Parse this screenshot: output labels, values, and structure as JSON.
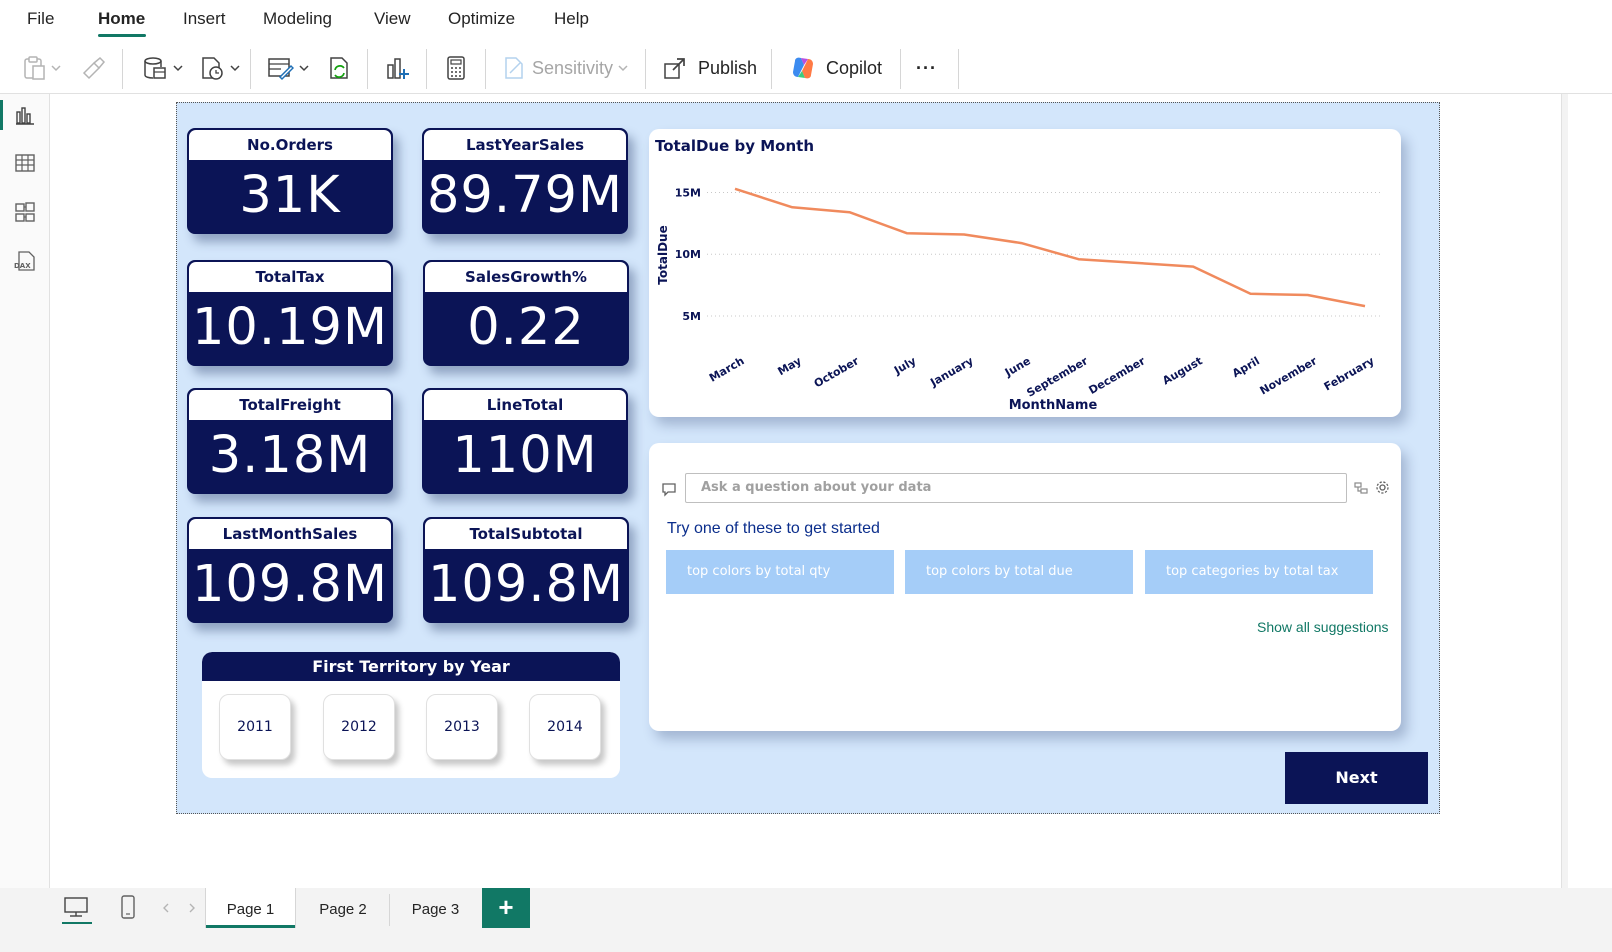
{
  "menu": {
    "items": [
      "File",
      "Home",
      "Insert",
      "Modeling",
      "View",
      "Optimize",
      "Help"
    ],
    "active": "Home"
  },
  "ribbon": {
    "sensitivity_label": "Sensitivity",
    "publish_label": "Publish",
    "copilot_label": "Copilot",
    "more_label": "···"
  },
  "colors": {
    "accent": "#117865",
    "navy": "#0b1456",
    "report_bg": "#d3e6fb",
    "line": "#f08a5d",
    "chip": "#a5cdf8"
  },
  "kpis": [
    {
      "title": "No.Orders",
      "value": "31K"
    },
    {
      "title": "LastYearSales",
      "value": "89.79M"
    },
    {
      "title": "TotalTax",
      "value": "10.19M"
    },
    {
      "title": "SalesGrowth%",
      "value": "0.22"
    },
    {
      "title": "TotalFreight",
      "value": "3.18M"
    },
    {
      "title": "LineTotal",
      "value": "110M"
    },
    {
      "title": "LastMonthSales",
      "value": "109.8M"
    },
    {
      "title": "TotalSubtotal",
      "value": "109.8M"
    }
  ],
  "chart_data": {
    "type": "line",
    "title": "TotalDue by Month",
    "xlabel": "MonthName",
    "ylabel": "TotalDue",
    "categories": [
      "March",
      "May",
      "October",
      "July",
      "January",
      "June",
      "September",
      "December",
      "August",
      "April",
      "November",
      "February"
    ],
    "series": [
      {
        "values": [
          15.3,
          13.8,
          13.4,
          11.7,
          11.6,
          10.9,
          9.6,
          9.3,
          9.0,
          6.8,
          6.7,
          5.8
        ]
      }
    ],
    "y_ticks": [
      {
        "value": 5,
        "label": "5M"
      },
      {
        "value": 10,
        "label": "10M"
      },
      {
        "value": 15,
        "label": "15M"
      }
    ],
    "ylim": [
      3.3,
      16.9
    ],
    "grid": true,
    "line_color": "#f08a5d"
  },
  "qa": {
    "placeholder": "Ask a question about your data",
    "prompt": "Try one of these to get started",
    "suggestions": [
      "top colors by total qty",
      "top colors by total due",
      "top categories by total tax"
    ],
    "show_all": "Show all suggestions"
  },
  "territory": {
    "title": "First Territory by Year",
    "years": [
      "2011",
      "2012",
      "2013",
      "2014"
    ]
  },
  "next_label": "Next",
  "pages": {
    "tabs": [
      "Page 1",
      "Page 2",
      "Page 3"
    ],
    "active": "Page 1",
    "add_label": "+"
  }
}
